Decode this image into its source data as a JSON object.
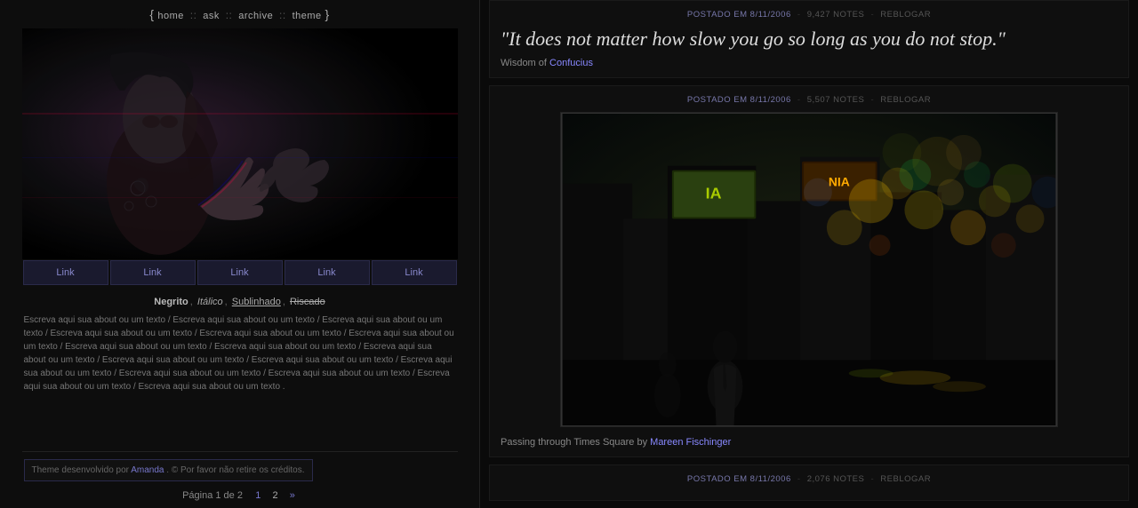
{
  "nav": {
    "brace_open": "{",
    "brace_close": "}",
    "links": [
      {
        "label": "home",
        "href": "#"
      },
      {
        "label": "ask",
        "href": "#"
      },
      {
        "label": "archive",
        "href": "#"
      },
      {
        "label": "theme",
        "href": "#"
      }
    ],
    "sep": "::"
  },
  "link_bar": {
    "links": [
      "Link",
      "Link",
      "Link",
      "Link",
      "Link"
    ]
  },
  "text_section": {
    "format_label": "Negrito, Itálico, Sublinhado, Riscado",
    "body": "Escreva aqui sua about ou um texto / Escreva aqui sua about ou um texto / Escreva aqui sua about ou um texto / Escreva aqui sua about ou um texto / Escreva aqui sua about ou um texto / Escreva aqui sua about ou um texto / Escreva aqui sua about ou um texto / Escreva aqui sua about ou um texto / Escreva aqui sua about ou um texto / Escreva aqui sua about ou um texto / Escreva aqui sua about ou um texto / Escreva aqui sua about ou um texto / Escreva aqui sua about ou um texto / Escreva aqui sua about ou um texto / Escreva aqui sua about ou um texto / Escreva aqui sua about ou um texto ."
  },
  "footer": {
    "theme_text": "Theme desenvolvido por",
    "theme_author": "Amanda",
    "theme_note": ". © Por favor não retire os créditos.",
    "pagination_text": "Página 1 de 2",
    "page_1": "1",
    "page_2": "2",
    "arrows": "»"
  },
  "posts": [
    {
      "id": "post1",
      "type": "quote",
      "meta_date": "POSTADO EM 8/11/2006",
      "meta_notes": "9,427 NOTES",
      "meta_reblog": "REBLOGAR",
      "quote_text": "\"It does not matter how slow you go so long as you do not stop.\"",
      "quote_source": "Wisdom of",
      "quote_author": "Confucius",
      "quote_author_href": "#"
    },
    {
      "id": "post2",
      "type": "photo",
      "meta_date": "POSTADO EM 8/11/2006",
      "meta_notes": "5,507 NOTES",
      "meta_reblog": "REBLOGAR",
      "caption_text": "Passing through Times Square by",
      "caption_author": "Mareen Fischinger",
      "caption_author_href": "#"
    },
    {
      "id": "post3",
      "type": "generic",
      "meta_date": "POSTADO EM 8/11/2006",
      "meta_notes": "2,076 NOTES",
      "meta_reblog": "REBLOGAR"
    }
  ],
  "colors": {
    "accent": "#7777cc",
    "date": "#7777aa",
    "bg": "#0a0a0a",
    "panel_bg": "#0f0f0f"
  }
}
